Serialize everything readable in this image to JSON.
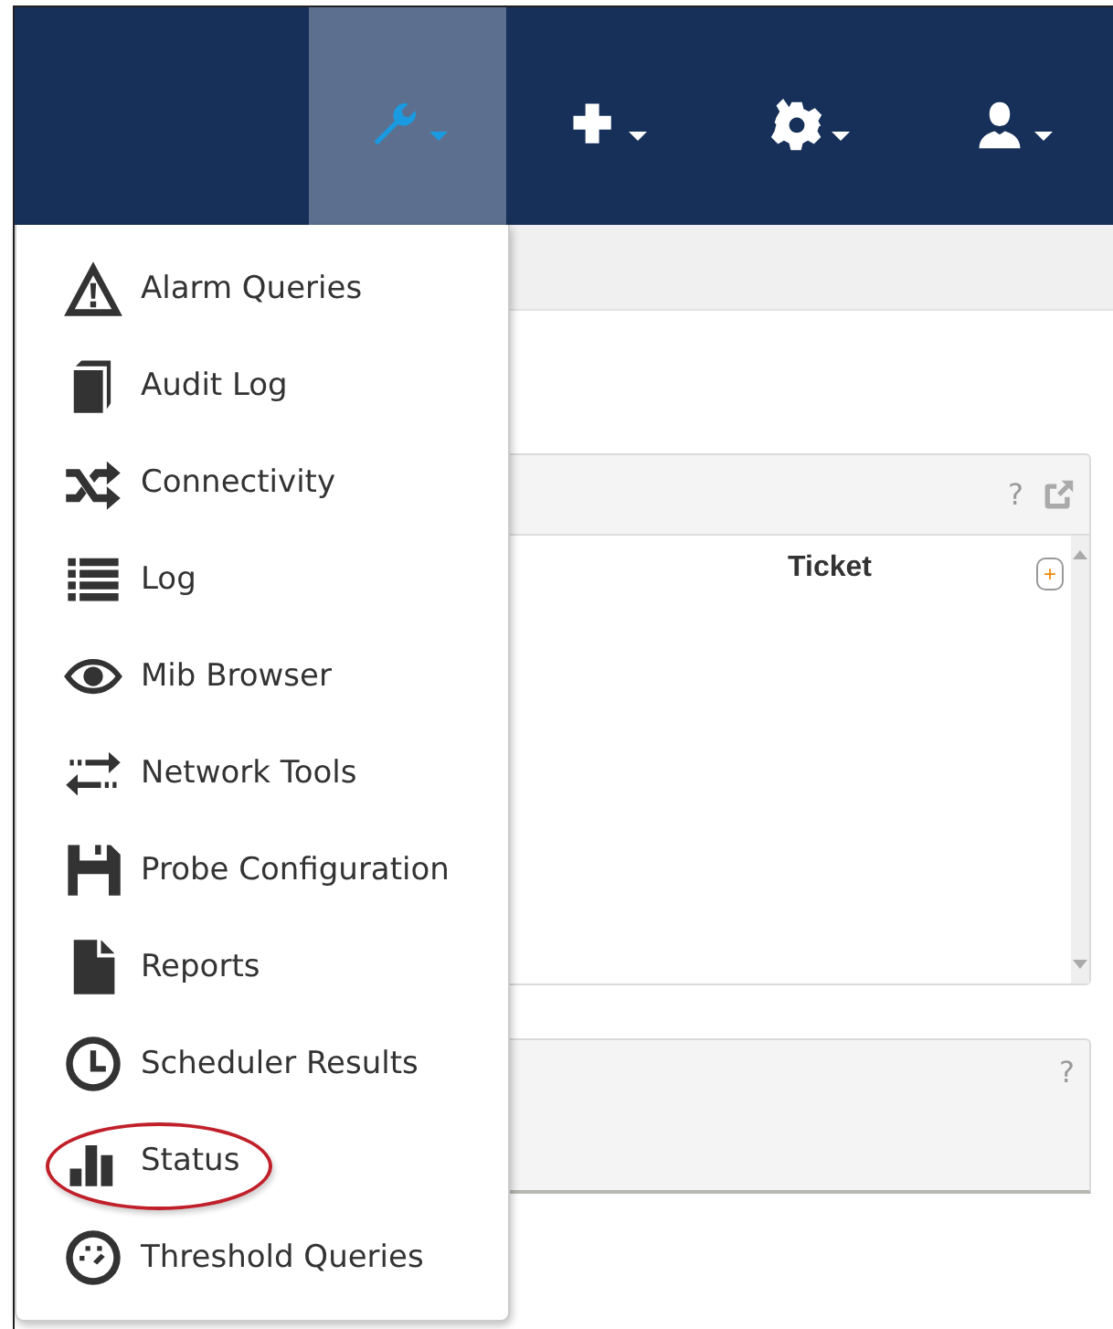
{
  "navbar": {
    "items": [
      {
        "selected": true
      },
      {
        "selected": false
      },
      {
        "selected": false
      },
      {
        "selected": false
      }
    ]
  },
  "tools_menu": {
    "items": [
      {
        "label": "Alarm Queries",
        "circled": false
      },
      {
        "label": "Audit Log",
        "circled": false
      },
      {
        "label": "Connectivity",
        "circled": false
      },
      {
        "label": "Log",
        "circled": false
      },
      {
        "label": "Mib Browser",
        "circled": false
      },
      {
        "label": "Network Tools",
        "circled": false
      },
      {
        "label": "Probe Configuration",
        "circled": false
      },
      {
        "label": "Reports",
        "circled": false
      },
      {
        "label": "Scheduler Results",
        "circled": false
      },
      {
        "label": "Status",
        "circled": true
      },
      {
        "label": "Threshold Queries",
        "circled": false
      }
    ]
  },
  "panels": [
    {
      "help": "?",
      "columns": [
        {
          "label": "Ticket",
          "add_button": "+"
        }
      ]
    },
    {
      "help": "?"
    }
  ]
}
